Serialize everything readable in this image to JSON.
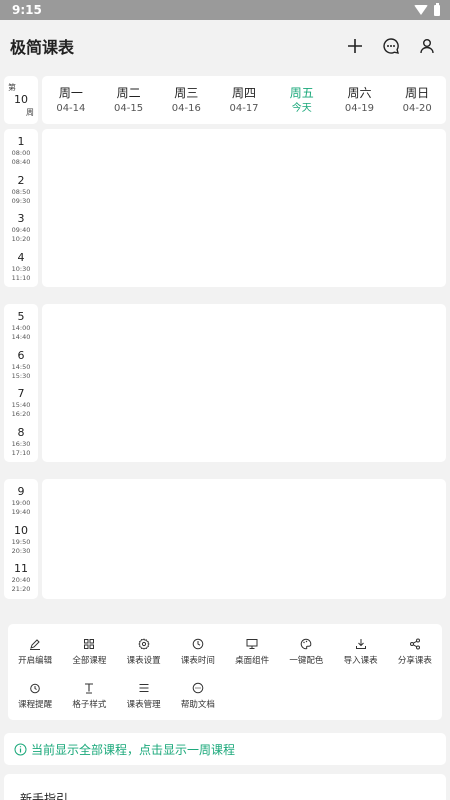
{
  "status": {
    "time": "9:15"
  },
  "app": {
    "title": "极简课表"
  },
  "week": {
    "prefix": "第",
    "number": "10",
    "suffix": "周"
  },
  "days": [
    {
      "name": "周一",
      "date": "04-14",
      "today": false
    },
    {
      "name": "周二",
      "date": "04-15",
      "today": false
    },
    {
      "name": "周三",
      "date": "04-16",
      "today": false
    },
    {
      "name": "周四",
      "date": "04-17",
      "today": false
    },
    {
      "name": "周五",
      "date": "今天",
      "today": true
    },
    {
      "name": "周六",
      "date": "04-19",
      "today": false
    },
    {
      "name": "周日",
      "date": "04-20",
      "today": false
    }
  ],
  "periods": [
    {
      "num": "1",
      "start": "08:00",
      "end": "08:40"
    },
    {
      "num": "2",
      "start": "08:50",
      "end": "09:30"
    },
    {
      "num": "3",
      "start": "09:40",
      "end": "10:20"
    },
    {
      "num": "4",
      "start": "10:30",
      "end": "11:10"
    },
    {
      "num": "5",
      "start": "14:00",
      "end": "14:40"
    },
    {
      "num": "6",
      "start": "14:50",
      "end": "15:30"
    },
    {
      "num": "7",
      "start": "15:40",
      "end": "16:20"
    },
    {
      "num": "8",
      "start": "16:30",
      "end": "17:10"
    },
    {
      "num": "9",
      "start": "19:00",
      "end": "19:40"
    },
    {
      "num": "10",
      "start": "19:50",
      "end": "20:30"
    },
    {
      "num": "11",
      "start": "20:40",
      "end": "21:20"
    }
  ],
  "tools": [
    {
      "label": "开启编辑",
      "icon": "pencil-icon"
    },
    {
      "label": "全部课程",
      "icon": "grid-icon"
    },
    {
      "label": "课表设置",
      "icon": "gear-icon"
    },
    {
      "label": "课表时间",
      "icon": "clock-icon"
    },
    {
      "label": "桌面组件",
      "icon": "monitor-icon"
    },
    {
      "label": "一键配色",
      "icon": "palette-icon"
    },
    {
      "label": "导入课表",
      "icon": "download-icon"
    },
    {
      "label": "分享课表",
      "icon": "share-icon"
    },
    {
      "label": "课程提醒",
      "icon": "alarm-icon"
    },
    {
      "label": "格子样式",
      "icon": "text-style-icon"
    },
    {
      "label": "课表管理",
      "icon": "list-icon"
    },
    {
      "label": "帮助文档",
      "icon": "help-chat-icon"
    }
  ],
  "notice": {
    "text": "当前显示全部课程，点击显示一周课程"
  },
  "guide": {
    "title": "新手指引"
  },
  "colors": {
    "accent": "#1aa87a",
    "background": "#f2f2f2",
    "statusbar": "#9a9a9a"
  }
}
